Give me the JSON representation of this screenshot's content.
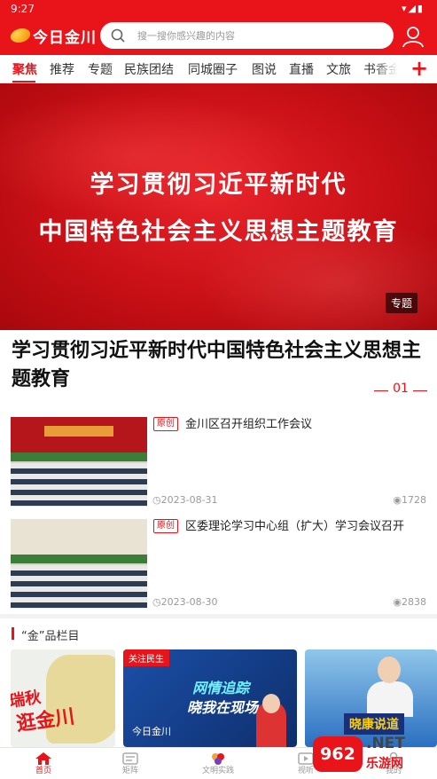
{
  "status": {
    "time": "9:27",
    "signal": "▾◢▮"
  },
  "header": {
    "logo_text": "今日金川",
    "search_placeholder": "搜一搜你感兴趣的内容"
  },
  "tabs": [
    "聚焦",
    "推荐",
    "专题",
    "民族团结",
    "同城圈子",
    "图说",
    "直播",
    "文旅",
    "书香金"
  ],
  "add_tab_symbol": "+",
  "banner": {
    "line1": "学习贯彻习近平新时代",
    "line2": "中国特色社会主义思想主题教育",
    "badge": "专题"
  },
  "headline": {
    "title": "学习贯彻习近平新时代中国特色社会主义思想主题教育",
    "page": "01"
  },
  "news": [
    {
      "tag": "原创",
      "title": "金川区召开组织工作会议",
      "date": "2023-08-31",
      "views": "1728"
    },
    {
      "tag": "原创",
      "title": "区委理论学习中心组（扩大）学习会议召开",
      "date": "2023-08-30",
      "views": "2838"
    }
  ],
  "section": {
    "title": "“金”品栏目",
    "cards": [
      {
        "text1": "瑞秋",
        "text2": "逛金川"
      },
      {
        "flag": "关注民生",
        "h1": "网情追踪",
        "h2": "晓我在现场",
        "brand": "今日金川"
      },
      {
        "banner": "晓康说道"
      }
    ]
  },
  "watermark": {
    "badge": "962",
    "net": ".NET",
    "sub": "乐游网"
  },
  "bottom_nav": [
    {
      "label": "首页",
      "icon": "home-icon"
    },
    {
      "label": "矩阵",
      "icon": "matrix-icon"
    },
    {
      "label": "文明实践",
      "icon": "flower-icon"
    },
    {
      "label": "视听",
      "icon": "video-icon"
    },
    {
      "label": "我的",
      "icon": "profile-icon"
    }
  ],
  "colors": {
    "brand": "#e8141a",
    "header_bg": "#e8141a"
  }
}
